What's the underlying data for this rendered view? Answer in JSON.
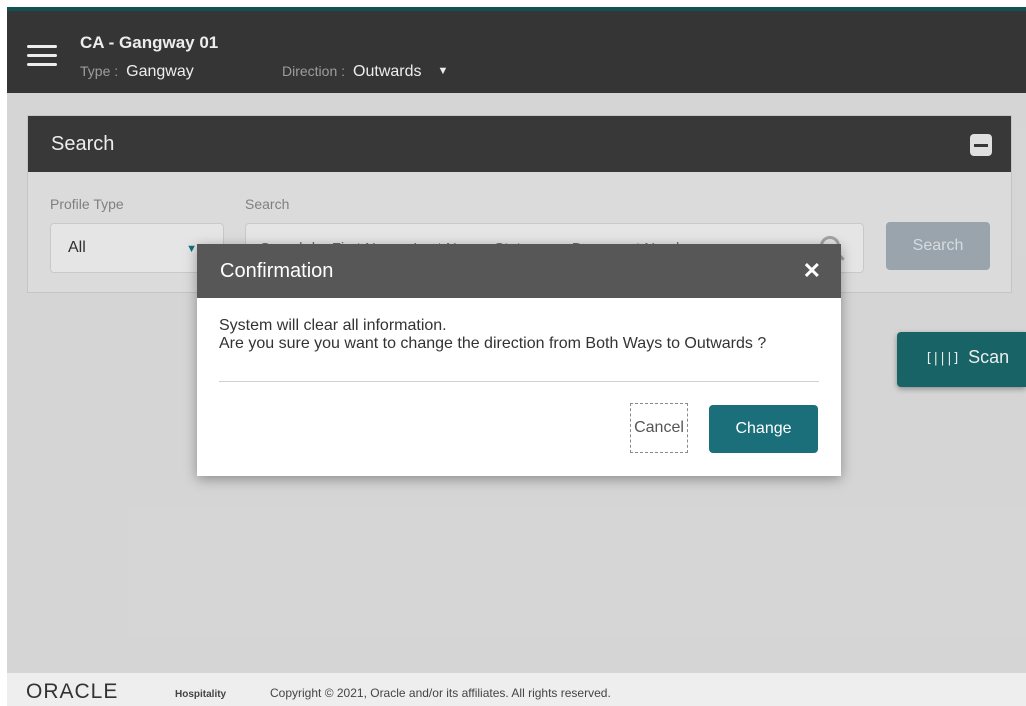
{
  "header": {
    "title": "CA - Gangway 01",
    "type_label": "Type :",
    "type_value": "Gangway",
    "direction_label": "Direction :",
    "direction_value": "Outwards"
  },
  "search_panel": {
    "title": "Search",
    "profile_type_label": "Profile Type",
    "profile_type_value": "All",
    "search_label": "Search",
    "search_placeholder": "Search by First Name, Last Name, Stateroom, Document Number",
    "search_button": "Search"
  },
  "scan": {
    "label": "Scan"
  },
  "dialog": {
    "title": "Confirmation",
    "line1": "System will clear all information.",
    "line2": "Are you sure you want to change the direction from Both Ways to Outwards ?",
    "cancel_label": "Cancel",
    "change_label": "Change"
  },
  "footer": {
    "logo": "ORACLE",
    "logo_sub": "Hospitality",
    "copyright": "Copyright © 2021, Oracle and/or its affiliates. All rights reserved."
  },
  "colors": {
    "accent": "#1b6f7a",
    "header_bg": "#3a3a3a",
    "top_stripe": "#135a5c"
  }
}
